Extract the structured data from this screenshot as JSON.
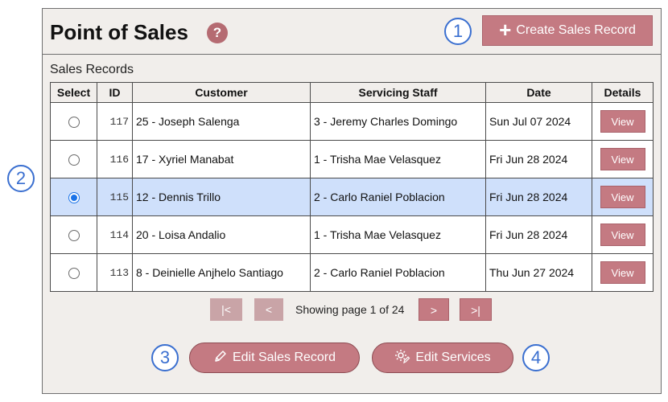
{
  "header": {
    "title": "Point of Sales",
    "help_icon": "?",
    "create_button_label": "Create Sales Record"
  },
  "section_label": "Sales Records",
  "table": {
    "columns": [
      "Select",
      "ID",
      "Customer",
      "Servicing Staff",
      "Date",
      "Details"
    ],
    "rows": [
      {
        "id": "117",
        "customer": "25 - Joseph Salenga",
        "staff": "3 - Jeremy Charles Domingo",
        "date": "Sun Jul 07 2024",
        "details": "View",
        "selected": false
      },
      {
        "id": "116",
        "customer": "17 - Xyriel Manabat",
        "staff": "1 - Trisha Mae Velasquez",
        "date": "Fri Jun 28 2024",
        "details": "View",
        "selected": false
      },
      {
        "id": "115",
        "customer": "12 - Dennis Trillo",
        "staff": "2 - Carlo Raniel Poblacion",
        "date": "Fri Jun 28 2024",
        "details": "View",
        "selected": true
      },
      {
        "id": "114",
        "customer": "20 - Loisa Andalio",
        "staff": "1 - Trisha Mae Velasquez",
        "date": "Fri Jun 28 2024",
        "details": "View",
        "selected": false
      },
      {
        "id": "113",
        "customer": "8 - Deinielle Anjhelo Santiago",
        "staff": "2 - Carlo Raniel Poblacion",
        "date": "Thu Jun 27 2024",
        "details": "View",
        "selected": false
      }
    ]
  },
  "pagination": {
    "first": "|<",
    "prev": "<",
    "info": "Showing page 1 of 24",
    "next": ">",
    "last": ">|"
  },
  "actions": {
    "edit_sales_record": "Edit Sales Record",
    "edit_services": "Edit Services"
  },
  "markers": [
    "1",
    "2",
    "3",
    "4"
  ],
  "colors": {
    "panel_bg": "#f1eeeb",
    "button": "#c47a82",
    "button_disabled": "#c9a4a7",
    "selected_row": "#cfe0fb",
    "marker": "#3a6fd0"
  },
  "icons": {
    "help": "help-icon",
    "create": "plus-icon",
    "edit_sales_record": "pencil-icon",
    "edit_services": "gear-edit-icon"
  }
}
